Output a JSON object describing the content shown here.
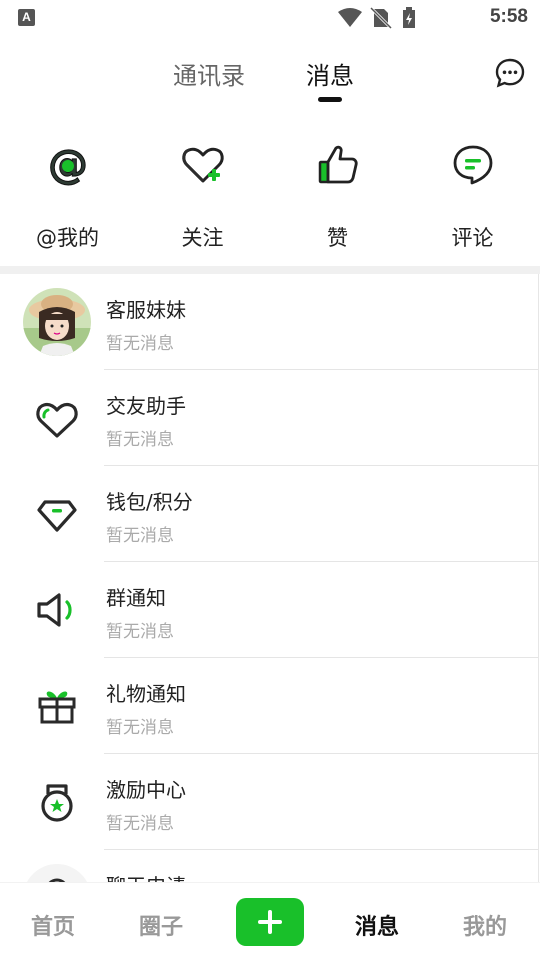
{
  "status_bar": {
    "time": "5:58",
    "notification_letter": "A"
  },
  "header": {
    "tabs": [
      {
        "label": "通讯录",
        "active": false
      },
      {
        "label": "消息",
        "active": true
      }
    ],
    "chat_icon": "chat-bubble-icon"
  },
  "quick_actions": [
    {
      "label": "@我的",
      "icon": "at-icon"
    },
    {
      "label": "关注",
      "icon": "heart-plus-icon"
    },
    {
      "label": "赞",
      "icon": "thumbs-up-icon"
    },
    {
      "label": "评论",
      "icon": "comment-icon"
    }
  ],
  "messages": [
    {
      "title": "客服妹妹",
      "subtitle": "暂无消息",
      "icon": "avatar"
    },
    {
      "title": "交友助手",
      "subtitle": "暂无消息",
      "icon": "heart-icon"
    },
    {
      "title": "钱包/积分",
      "subtitle": "暂无消息",
      "icon": "diamond-icon"
    },
    {
      "title": "群通知",
      "subtitle": "暂无消息",
      "icon": "speaker-icon"
    },
    {
      "title": "礼物通知",
      "subtitle": "暂无消息",
      "icon": "gift-icon"
    },
    {
      "title": "激励中心",
      "subtitle": "暂无消息",
      "icon": "medal-icon"
    },
    {
      "title": "聊天申请",
      "subtitle": "",
      "icon": "chat-request-icon"
    }
  ],
  "bottom_nav": [
    {
      "label": "首页",
      "active": false
    },
    {
      "label": "圈子",
      "active": false
    },
    {
      "label": "消息",
      "active": true
    },
    {
      "label": "我的",
      "active": false
    }
  ],
  "colors": {
    "accent": "#19c02a",
    "text": "#222222",
    "muted": "#aaaaaa"
  }
}
